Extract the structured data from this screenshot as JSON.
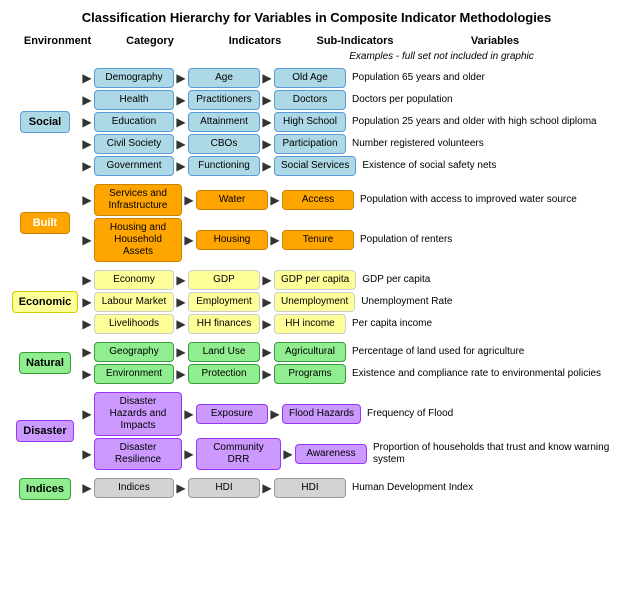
{
  "title": "Classification Hierarchy for Variables in Composite Indicator Methodologies",
  "columns": {
    "environment": "Environment",
    "category": "Category",
    "indicators": "Indicators",
    "sub_indicators": "Sub-Indicators",
    "variables": "Variables"
  },
  "examples_note": "Examples - full set not included in graphic",
  "groups": [
    {
      "id": "social",
      "env_label": "Social",
      "env_class": "env-social",
      "rows": [
        {
          "cat": "Demography",
          "cat_class": "box-blue",
          "ind": "Age",
          "ind_class": "box-blue",
          "sub": "Old Age",
          "sub_class": "box-blue",
          "var": "Population 65 years and older"
        },
        {
          "cat": "Health",
          "cat_class": "box-blue",
          "ind": "Practitioners",
          "ind_class": "box-blue",
          "sub": "Doctors",
          "sub_class": "box-blue",
          "var": "Doctors per population"
        },
        {
          "cat": "Education",
          "cat_class": "box-blue",
          "ind": "Attainment",
          "ind_class": "box-blue",
          "sub": "High School",
          "sub_class": "box-blue",
          "var": "Population 25 years and older with high school diploma"
        },
        {
          "cat": "Civil Society",
          "cat_class": "box-blue",
          "ind": "CBOs",
          "ind_class": "box-blue",
          "sub": "Participation",
          "sub_class": "box-blue",
          "var": "Number registered volunteers"
        },
        {
          "cat": "Government",
          "cat_class": "box-blue",
          "ind": "Functioning",
          "ind_class": "box-blue",
          "sub": "Social Services",
          "sub_class": "box-blue",
          "var": "Existence of social safety nets"
        }
      ]
    },
    {
      "id": "built",
      "env_label": "Built",
      "env_class": "env-built",
      "rows": [
        {
          "cat": "Services and Infrastructure",
          "cat_class": "box-orange",
          "ind": "Water",
          "ind_class": "box-orange",
          "sub": "Access",
          "sub_class": "box-orange",
          "var": "Population with access to improved water source"
        },
        {
          "cat": "Housing and Household Assets",
          "cat_class": "box-orange",
          "ind": "Housing",
          "ind_class": "box-orange",
          "sub": "Tenure",
          "sub_class": "box-orange",
          "var": "Population of renters"
        }
      ]
    },
    {
      "id": "economic",
      "env_label": "Economic",
      "env_class": "env-economic",
      "rows": [
        {
          "cat": "Economy",
          "cat_class": "box-yellow",
          "ind": "GDP",
          "ind_class": "box-yellow",
          "sub": "GDP per capita",
          "sub_class": "box-yellow",
          "var": "GDP per capita"
        },
        {
          "cat": "Labour Market",
          "cat_class": "box-yellow",
          "ind": "Employment",
          "ind_class": "box-yellow",
          "sub": "Unemployment",
          "sub_class": "box-yellow",
          "var": "Unemployment Rate"
        },
        {
          "cat": "Livelihoods",
          "cat_class": "box-yellow",
          "ind": "HH finances",
          "ind_class": "box-yellow",
          "sub": "HH income",
          "sub_class": "box-yellow",
          "var": "Per capita income"
        }
      ]
    },
    {
      "id": "natural",
      "env_label": "Natural",
      "env_class": "env-natural",
      "rows": [
        {
          "cat": "Geography",
          "cat_class": "box-green",
          "ind": "Land Use",
          "ind_class": "box-green",
          "sub": "Agricultural",
          "sub_class": "box-green",
          "var": "Percentage of land used for agriculture"
        },
        {
          "cat": "Environment",
          "cat_class": "box-green",
          "ind": "Protection",
          "ind_class": "box-green",
          "sub": "Programs",
          "sub_class": "box-green",
          "var": "Existence and compliance rate to environmental policies"
        }
      ]
    },
    {
      "id": "disaster",
      "env_label": "Disaster",
      "env_class": "env-disaster",
      "rows": [
        {
          "cat": "Disaster Hazards and Impacts",
          "cat_class": "box-purple",
          "ind": "Exposure",
          "ind_class": "box-purple",
          "sub": "Flood Hazards",
          "sub_class": "box-purple",
          "var": "Frequency of Flood"
        },
        {
          "cat": "Disaster Resilience",
          "cat_class": "box-purple",
          "ind": "Community DRR",
          "ind_class": "box-purple",
          "sub": "Awareness",
          "sub_class": "box-purple",
          "var": "Proportion of households that trust and know warning system"
        }
      ]
    },
    {
      "id": "indices",
      "env_label": "Indices",
      "env_class": "env-indices",
      "rows": [
        {
          "cat": "Indices",
          "cat_class": "box-gray",
          "ind": "HDI",
          "ind_class": "box-gray",
          "sub": "HDI",
          "sub_class": "box-gray",
          "var": "Human Development Index"
        }
      ]
    }
  ]
}
